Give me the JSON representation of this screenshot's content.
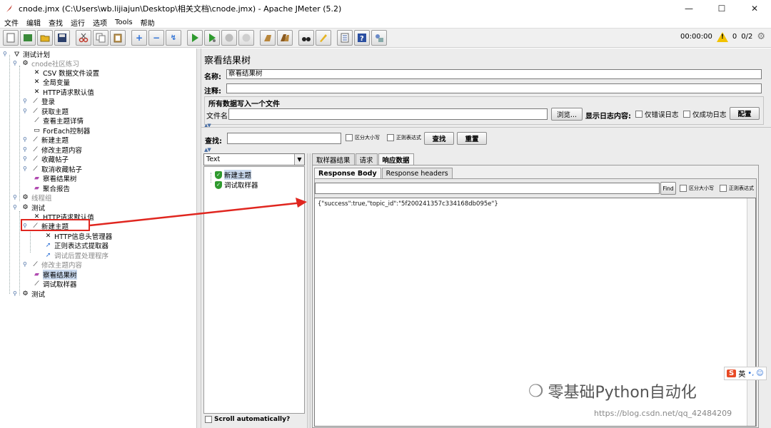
{
  "window": {
    "title": "cnode.jmx (C:\\Users\\wb.lijiajun\\Desktop\\相关文档\\cnode.jmx) - Apache JMeter (5.2)",
    "controls": [
      "—",
      "☐",
      "✕"
    ]
  },
  "menu": [
    "文件",
    "编辑",
    "查找",
    "运行",
    "选项",
    "Tools",
    "帮助"
  ],
  "toolbar": {
    "timer": "00:00:00",
    "warn_count": "0",
    "threads": "0/2"
  },
  "tree": {
    "items": [
      {
        "label": "测试计划",
        "icon": "flask-icon"
      },
      {
        "label": "cnode社区练习",
        "icon": "gear-icon"
      },
      {
        "label": "CSV 数据文件设置",
        "icon": "wrench-icon"
      },
      {
        "label": "全局变量",
        "icon": "wrench-icon"
      },
      {
        "label": "HTTP请求默认值",
        "icon": "wrench-icon"
      },
      {
        "label": "登录",
        "icon": "pipette-icon"
      },
      {
        "label": "获取主题",
        "icon": "pipette-icon"
      },
      {
        "label": "查看主题详情",
        "icon": "pipette-icon"
      },
      {
        "label": "ForEach控制器",
        "icon": "document-icon"
      },
      {
        "label": "新建主题",
        "icon": "pipette-icon"
      },
      {
        "label": "修改主题内容",
        "icon": "pipette-icon"
      },
      {
        "label": "收藏帖子",
        "icon": "pipette-icon"
      },
      {
        "label": "取消收藏帖子",
        "icon": "pipette-icon"
      },
      {
        "label": "察看结果树",
        "icon": "chart-icon"
      },
      {
        "label": "聚合报告",
        "icon": "chart-icon"
      },
      {
        "label": "线程组",
        "icon": "gear-icon"
      },
      {
        "label": "测试",
        "icon": "gear-icon"
      },
      {
        "label": "HTTP请求默认值",
        "icon": "wrench-icon"
      },
      {
        "label": "新建主题",
        "icon": "pipette-icon"
      },
      {
        "label": "HTTP信息头管理器",
        "icon": "wrench-icon"
      },
      {
        "label": "正则表达式提取器",
        "icon": "extractor-icon"
      },
      {
        "label": "调试后置处理程序",
        "icon": "extractor-icon"
      },
      {
        "label": "修改主题内容",
        "icon": "pipette-icon"
      },
      {
        "label": "察看结果树",
        "icon": "chart-icon"
      },
      {
        "label": "调试取样器",
        "icon": "pipette-icon"
      },
      {
        "label": "测试",
        "icon": "gear-icon"
      }
    ]
  },
  "panel": {
    "title": "察看结果树",
    "name_label": "名称:",
    "name_value": "察看结果树",
    "comment_label": "注释:",
    "comment_value": "",
    "group_title": "所有数据写入一个文件",
    "filename_label": "文件名",
    "browse": "浏览...",
    "log_label": "显示日志内容:",
    "errors_only": "仅错误日志",
    "success_only": "仅成功日志",
    "configure": "配置",
    "search_label": "查找:",
    "case_sensitive": "区分大小写",
    "regex": "正则表达式",
    "find_button": "查找",
    "reset_button": "重置"
  },
  "results": {
    "renderer": "Text",
    "items": [
      "新建主题",
      "调试取样器"
    ],
    "scroll_auto": "Scroll automatically?",
    "tabs": [
      "取样器结果",
      "请求",
      "响应数据"
    ],
    "subtabs": [
      "Response Body",
      "Response headers"
    ],
    "find": "Find",
    "find_case": "区分大小写",
    "find_regex": "正则表达式",
    "body": "{\"success\":true,\"topic_id\":\"5f200241357c334168db095e\"}"
  },
  "overlay": {
    "watermark": "零基础Python自动化",
    "url": "https://blog.csdn.net/qq_42484209",
    "ime_s": "S",
    "ime_text": "英"
  },
  "colors": {
    "annotation": "#e0261f",
    "selection": "#c9d9ee",
    "shield": "#2e9a2e"
  }
}
